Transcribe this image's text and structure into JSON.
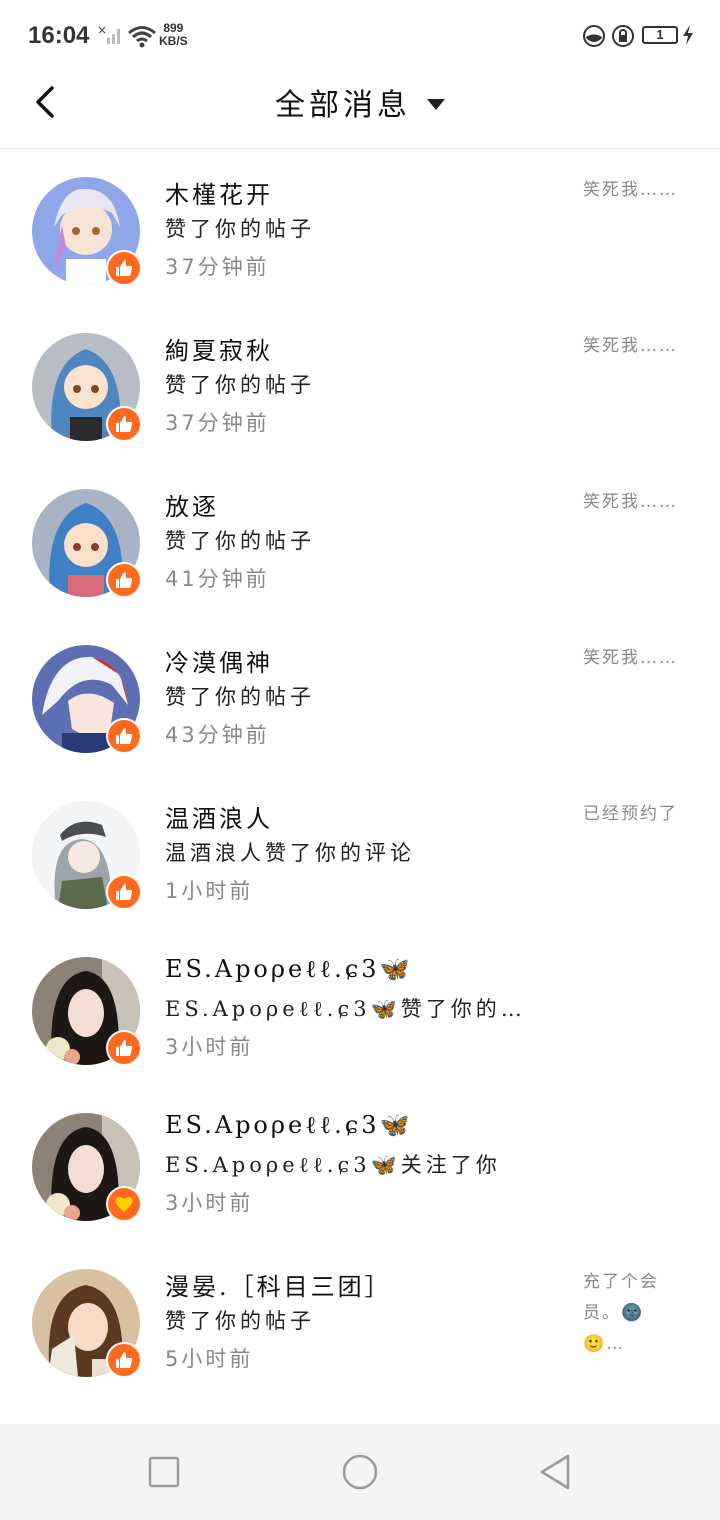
{
  "status": {
    "time": "16:04",
    "speed_value": "899",
    "speed_unit": "KB/S",
    "battery": "1"
  },
  "header": {
    "title": "全部消息"
  },
  "messages": [
    {
      "name": "木槿花开",
      "action": "赞了你的帖子",
      "time": "37分钟前",
      "preview": "笑死我……",
      "badge": "like-icon",
      "avatar_color": "#8fa6e8"
    },
    {
      "name": "絢夏寂秋",
      "action": "赞了你的帖子",
      "time": "37分钟前",
      "preview": "笑死我……",
      "badge": "like-icon",
      "avatar_color": "#7d9fc2"
    },
    {
      "name": "放逐",
      "action": "赞了你的帖子",
      "time": "41分钟前",
      "preview": "笑死我……",
      "badge": "like-icon",
      "avatar_color": "#8aa2c0"
    },
    {
      "name": "冷漠偶神",
      "action": "赞了你的帖子",
      "time": "43分钟前",
      "preview": "笑死我……",
      "badge": "like-icon",
      "avatar_color": "#5d6fb3"
    },
    {
      "name": "温酒浪人",
      "action": "温酒浪人赞了你的评论",
      "time": "1小时前",
      "preview": "已经预约了",
      "badge": "like-icon",
      "avatar_color": "#e9ecef"
    },
    {
      "name": "ES.Apoρeℓℓ.ɕ3🦋",
      "action": "ES.Apoρeℓℓ.ɕ3🦋赞了你的…",
      "time": "3小时前",
      "preview": "",
      "badge": "like-icon",
      "avatar_color": "#3b3230"
    },
    {
      "name": "ES.Apoρeℓℓ.ɕ3🦋",
      "action": "ES.Apoρeℓℓ.ɕ3🦋关注了你",
      "time": "3小时前",
      "preview": "",
      "badge": "heart-icon",
      "avatar_color": "#3b3230"
    },
    {
      "name": "漫晏.［科目三团］",
      "action": "赞了你的帖子",
      "time": "5小时前",
      "preview": "充了个会员。🌚🙂…",
      "badge": "like-icon",
      "avatar_color": "#c9a67f"
    }
  ]
}
